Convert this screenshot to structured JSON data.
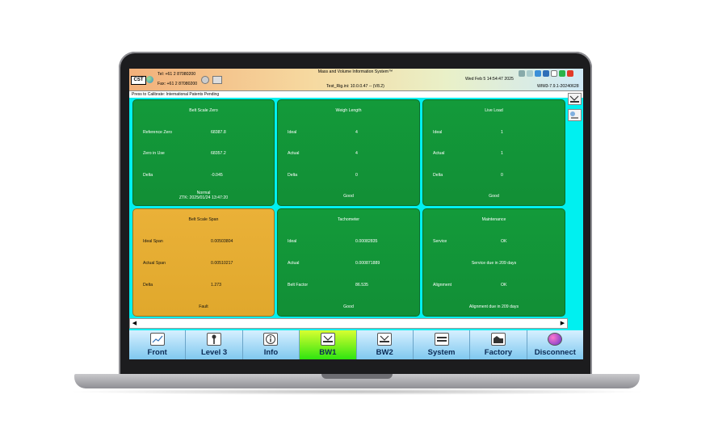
{
  "header": {
    "logo": "CST",
    "tel": "Tel: +61 2 87080200",
    "fax": "Fax: +61 2 87080200",
    "title": "Mass and Volume Information System™",
    "config": "Test_Rig.ini: 10.0.0.47 -- (V8.2)",
    "date": "Wed Feb 5 14:54:47 2025",
    "version": "WIM3-7.9.1-20240628"
  },
  "subbar": "Press to Calibrate: International Patents Pending",
  "panels": {
    "belt_zero": {
      "title": "Belt Scale Zero",
      "rows": [
        {
          "label": "Reference Zero",
          "value": "68387.8"
        },
        {
          "label": "Zero in Use",
          "value": "68357.2"
        },
        {
          "label": "Delta",
          "value": "-0.045"
        }
      ],
      "footer1": "Normal",
      "footer2": "ZTK: 2025/01/24 13:47:20"
    },
    "weigh_length": {
      "title": "Weigh Length",
      "rows": [
        {
          "label": "Ideal",
          "value": "4"
        },
        {
          "label": "Actual",
          "value": "4"
        },
        {
          "label": "Delta",
          "value": "0"
        }
      ],
      "footer": "Good"
    },
    "live_load": {
      "title": "Live Load",
      "rows": [
        {
          "label": "Ideal",
          "value": "1"
        },
        {
          "label": "Actual",
          "value": "1"
        },
        {
          "label": "Delta",
          "value": "0"
        }
      ],
      "footer": "Good"
    },
    "belt_span": {
      "title": "Belt Scale Span",
      "rows": [
        {
          "label": "Ideal Span",
          "value": "0.00503804"
        },
        {
          "label": "Actual Span",
          "value": "0.00510217"
        },
        {
          "label": "Delta",
          "value": "1.273"
        }
      ],
      "footer": "Fault"
    },
    "tachometer": {
      "title": "Tachometer",
      "rows": [
        {
          "label": "Ideal",
          "value": "0.00082835"
        },
        {
          "label": "Actual",
          "value": "0.000871889"
        },
        {
          "label": "Belt Factor",
          "value": "86.535"
        }
      ],
      "footer": "Good"
    },
    "maintenance": {
      "title": "Maintenance",
      "service_label": "Service",
      "service_value": "OK",
      "service_due": "Service due in 209 days",
      "alignment_label": "Alignment",
      "alignment_value": "OK",
      "alignment_due": "Alignment due in 209 days"
    }
  },
  "nav": [
    {
      "label": "Front",
      "icon": "chart-icon"
    },
    {
      "label": "Level 3",
      "icon": "key-icon"
    },
    {
      "label": "Info",
      "icon": "info-icon"
    },
    {
      "label": "BW1",
      "icon": "belt-scale-icon"
    },
    {
      "label": "BW2",
      "icon": "belt-scale-icon"
    },
    {
      "label": "System",
      "icon": "system-icon"
    },
    {
      "label": "Factory",
      "icon": "factory-icon"
    },
    {
      "label": "Disconnect",
      "icon": "globe-icon"
    }
  ],
  "nav_active": "BW1",
  "colors": {
    "panel_green": "#139a3a",
    "panel_fault": "#eab138",
    "screen_bg": "#00f0f0",
    "nav_active": "#2fe410"
  }
}
